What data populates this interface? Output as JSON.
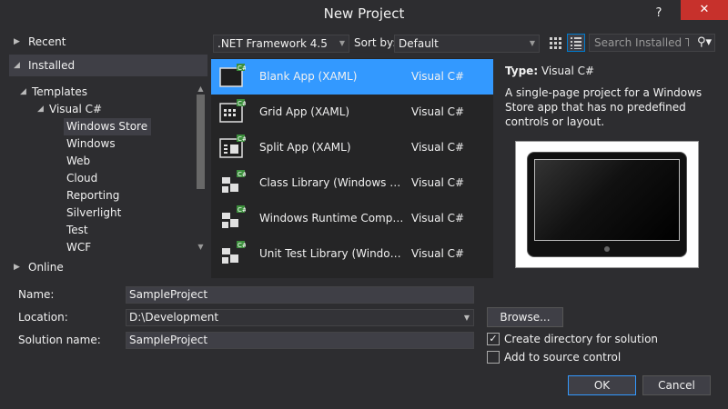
{
  "window": {
    "title": "New Project",
    "help": "?",
    "close": "✕"
  },
  "sidebar": {
    "recent": "Recent",
    "installed": "Installed",
    "online": "Online",
    "tree": [
      {
        "label": "Templates",
        "level": 0,
        "expanded": true
      },
      {
        "label": "Visual C#",
        "level": 1,
        "expanded": true
      },
      {
        "label": "Windows Store",
        "level": 2,
        "selected": true
      },
      {
        "label": "Windows",
        "level": 2
      },
      {
        "label": "Web",
        "level": 2
      },
      {
        "label": "Cloud",
        "level": 2
      },
      {
        "label": "Reporting",
        "level": 2
      },
      {
        "label": "Silverlight",
        "level": 2
      },
      {
        "label": "Test",
        "level": 2
      },
      {
        "label": "WCF",
        "level": 2
      }
    ]
  },
  "toolbar": {
    "framework": ".NET Framework 4.5",
    "sort_label": "Sort by:",
    "sort_value": "Default",
    "search_placeholder": "Search Installed Te"
  },
  "templates": [
    {
      "name": "Blank App (XAML)",
      "lang": "Visual C#",
      "selected": true,
      "icon": "blank-app-icon"
    },
    {
      "name": "Grid App (XAML)",
      "lang": "Visual C#",
      "icon": "grid-app-icon"
    },
    {
      "name": "Split App (XAML)",
      "lang": "Visual C#",
      "icon": "split-app-icon"
    },
    {
      "name": "Class Library (Windows Store apps)",
      "lang": "Visual C#",
      "icon": "class-library-icon"
    },
    {
      "name": "Windows Runtime Component",
      "lang": "Visual C#",
      "icon": "runtime-component-icon"
    },
    {
      "name": "Unit Test Library (Windows Store apps)",
      "lang": "Visual C#",
      "icon": "unit-test-icon"
    }
  ],
  "description": {
    "type_label": "Type:",
    "type_value": "Visual C#",
    "text": "A single-page project for a Windows Store app that has no predefined controls or layout."
  },
  "form": {
    "name_label": "Name:",
    "name_value": "SampleProject",
    "location_label": "Location:",
    "location_value": "D:\\Development",
    "solution_label": "Solution name:",
    "solution_value": "SampleProject",
    "browse_label": "Browse...",
    "create_dir_label": "Create directory for solution",
    "create_dir_checked": true,
    "source_control_label": "Add to source control",
    "source_control_checked": false,
    "ok_label": "OK",
    "cancel_label": "Cancel"
  }
}
